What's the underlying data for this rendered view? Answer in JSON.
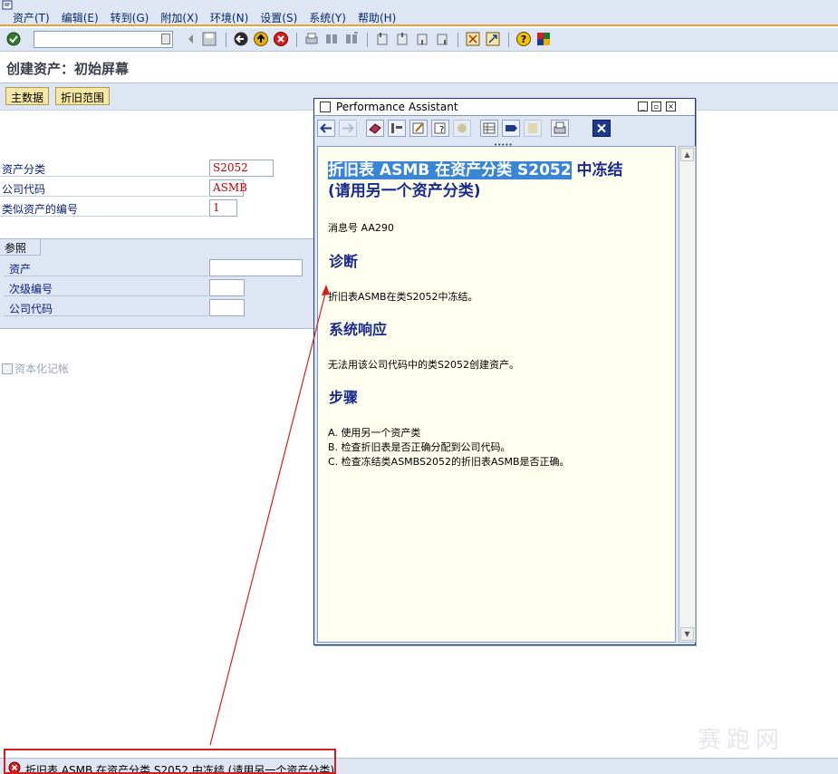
{
  "menu": {
    "items": [
      "资产(T)",
      "编辑(E)",
      "转到(G)",
      "附加(X)",
      "环境(N)",
      "设置(S)",
      "系统(Y)",
      "帮助(H)"
    ]
  },
  "toolbar": {
    "command_value": "",
    "icons": [
      "enter-icon",
      "back-icon",
      "exit-icon",
      "cancel-icon",
      "print-icon",
      "find-icon",
      "find-next-icon",
      "first-page-icon",
      "prev-page-icon",
      "next-page-icon",
      "last-page-icon",
      "create-session-icon",
      "shortcut-icon",
      "help-icon",
      "layout-icon"
    ]
  },
  "title": "创建资产：初始屏幕",
  "app_buttons": {
    "master_data": "主数据",
    "dep_areas": "折旧范围"
  },
  "form": {
    "asset_class_label": "资产分类",
    "asset_class_value": "S2052",
    "company_code_label": "公司代码",
    "company_code_value": "ASMB",
    "similar_count_label": "类似资产的编号",
    "similar_count_value": "1",
    "reference_header": "参照",
    "ref_asset_label": "资产",
    "ref_asset_value": "",
    "ref_subnumber_label": "次级编号",
    "ref_subnumber_value": "",
    "ref_company_label": "公司代码",
    "ref_company_value": "",
    "capitalization_label": "资本化记帐"
  },
  "performance_assistant": {
    "window_title": "Performance Assistant",
    "heading_highlight": "折旧表 ASMB 在资产分类 S2052",
    "heading_rest": " 中冻结",
    "heading_line2": "(请用另一个资产分类)",
    "message_no": "消息号 AA290",
    "diagnosis_title": "诊断",
    "diagnosis_text": "折旧表ASMB在类S2052中冻结。",
    "system_response_title": "系统响应",
    "system_response_text": "无法用该公司代码中的类S2052创建资产。",
    "procedure_title": "步骤",
    "procedure_steps": [
      "A. 使用另一个资产类",
      "B. 检查折旧表是否正确分配到公司代码。",
      "C. 检查冻结类ASMBS2052的折旧表ASMB是否正确。"
    ]
  },
  "status_bar": {
    "message": "折旧表 ASMB 在资产分类 S2052 中冻结 (请用另一个资产分类)",
    "type_color": "#d42020"
  },
  "colors": {
    "sap_blue_bg": "#dde6f2",
    "label_blue": "#0a1e7a",
    "heading_blue": "#1a2a8c",
    "highlight": "#3a86d4",
    "annotation_red": "#d42020"
  }
}
